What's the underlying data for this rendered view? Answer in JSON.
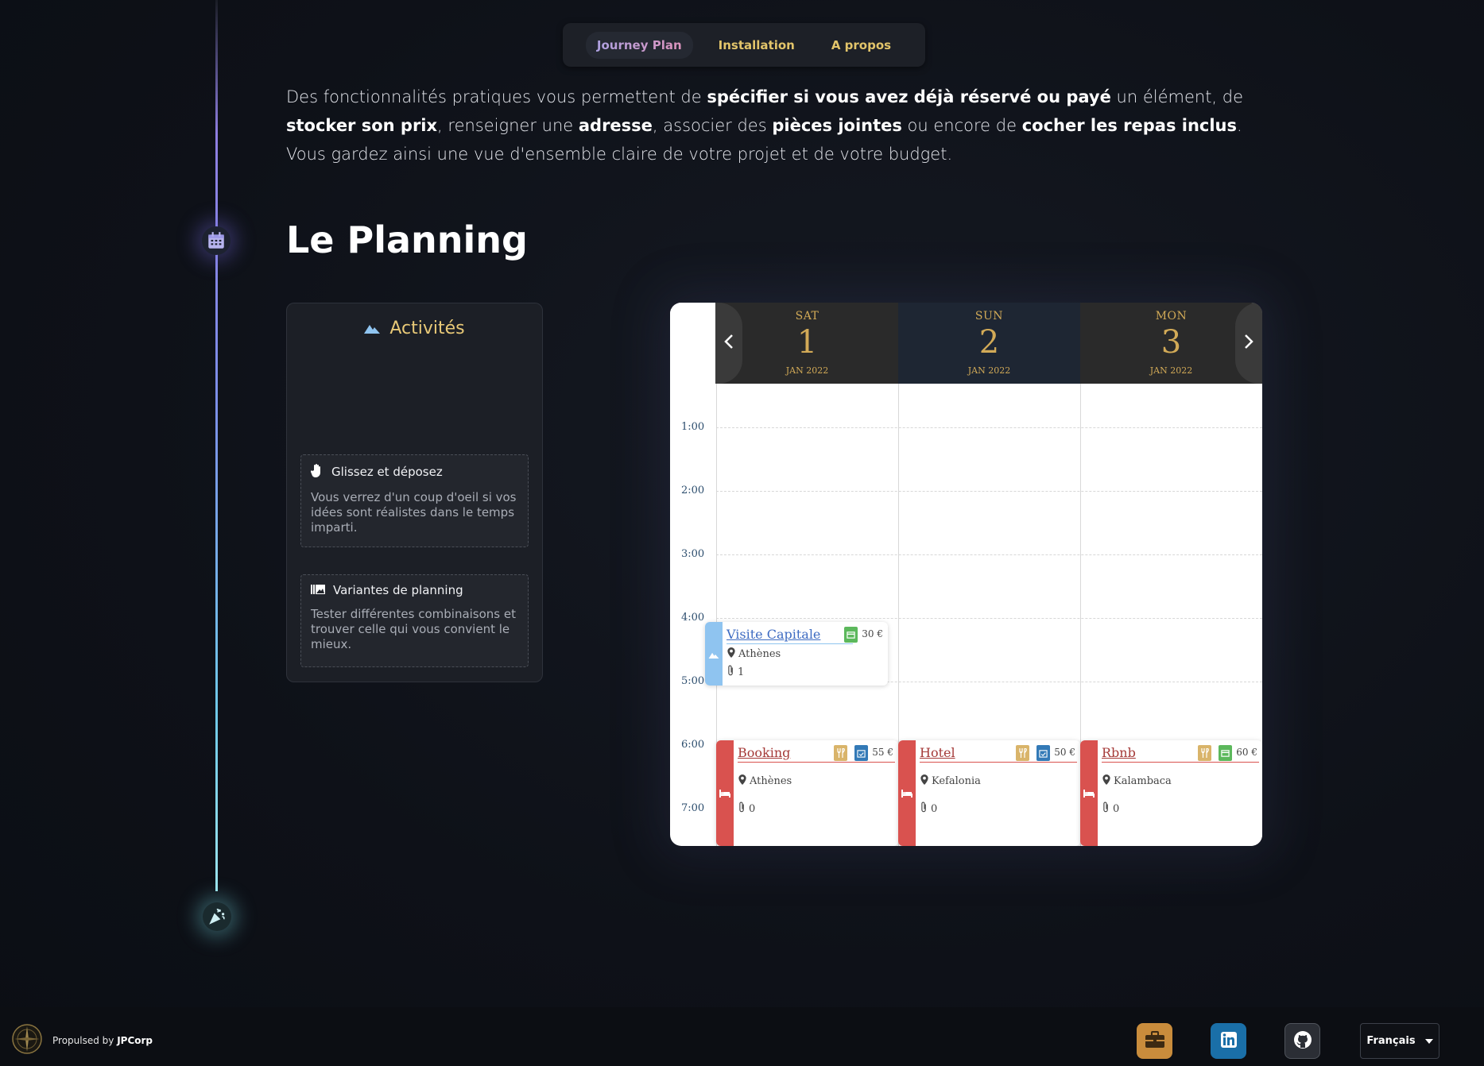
{
  "nav": {
    "items": [
      {
        "label": "Journey Plan",
        "active": true
      },
      {
        "label": "Installation",
        "active": false
      },
      {
        "label": "A propos",
        "active": false
      }
    ]
  },
  "intro": {
    "p1": "Des fonctionnalités pratiques vous permettent de ",
    "b1": "spécifier si vous avez déjà réservé ou payé",
    "p2": " un élément, de ",
    "b2": "stocker son prix",
    "p3": ", renseigner une ",
    "b3": "adresse",
    "p4": ", associer des ",
    "b4": "pièces jointes",
    "p5": " ou encore de ",
    "b5": "cocher les repas inclus",
    "p6": ". Vous gardez ainsi une vue d'ensemble claire de votre projet et de votre budget."
  },
  "section": {
    "title": "Le Planning"
  },
  "activities": {
    "title": "Activités",
    "cards": [
      {
        "heading": "Glissez et déposez",
        "body": "Vous verrez d'un coup d'oeil si vos idées sont réalistes dans le temps imparti."
      },
      {
        "heading": "Variantes de planning",
        "body": "Tester différentes combinaisons et trouver celle qui vous convient le mieux."
      }
    ]
  },
  "calendar": {
    "days": [
      {
        "name": "SAT",
        "num": "1",
        "month": "JAN 2022"
      },
      {
        "name": "SUN",
        "num": "2",
        "month": "JAN 2022"
      },
      {
        "name": "MON",
        "num": "3",
        "month": "JAN 2022"
      }
    ],
    "hours": [
      "1:00",
      "2:00",
      "3:00",
      "4:00",
      "5:00",
      "6:00",
      "7:00"
    ],
    "events": {
      "visite": {
        "title": "Visite Capitale",
        "price": "30 €",
        "place": "Athènes",
        "attachments": "1"
      },
      "booking": {
        "title": "Booking",
        "price": "55 €",
        "place": "Athènes",
        "attachments": "0"
      },
      "hotel": {
        "title": "Hotel",
        "price": "50 €",
        "place": "Kefalonia",
        "attachments": "0"
      },
      "rbnb": {
        "title": "Rbnb",
        "price": "60 €",
        "place": "Kalambaca",
        "attachments": "0"
      }
    },
    "colors": {
      "activity": "#8fc4f0",
      "lodging": "#d9524f",
      "paid": "#5cb85c",
      "booked": "#337ab7",
      "meal": "#d9b46a"
    }
  },
  "footer": {
    "propulsed": "Propulsed by ",
    "brand": "JPCorp",
    "language": "Français"
  }
}
